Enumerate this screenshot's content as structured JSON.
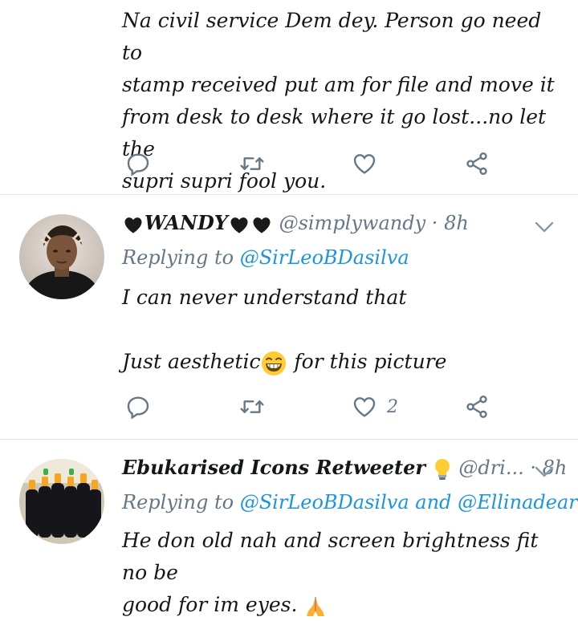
{
  "tweet1": {
    "text_lines": [
      "Na civil service Dem dey. Person go need to",
      "stamp received put am for file and move it",
      "from desk to desk where it go lost...no let the",
      "supri supri fool you."
    ],
    "like_count": ""
  },
  "tweet2": {
    "name": "WANDY",
    "handle": "@simplywandy",
    "dot": "·",
    "time": "8h",
    "replying_prefix": "Replying to",
    "replying_to": "@SirLeoBDasilva",
    "text_line1": "I can never understand that",
    "text_line2_before": "Just aesthetic",
    "text_line2_after": " for this picture",
    "like_count": "2"
  },
  "tweet3": {
    "name": "Ebukarised Icons Retweeter",
    "handle": "@dri...",
    "dot": "·",
    "time": "8h",
    "replying_prefix": "Replying to",
    "replying_to_1": "@SirLeoBDasilva",
    "replying_and": "and",
    "replying_to_2": "@Ellinadear",
    "text_line1": "He don old nah and screen brightness fit no be",
    "text_line2": "good for im eyes."
  },
  "colors": {
    "link": "#1b95e0",
    "muted": "#657786",
    "divider": "#e1e8ed"
  },
  "icons": [
    "reply-icon",
    "retweet-icon",
    "like-icon",
    "share-icon",
    "chevron-down-icon",
    "heart-emoji-icon",
    "grin-emoji-icon",
    "bulb-emoji-icon",
    "pray-emoji-icon"
  ]
}
